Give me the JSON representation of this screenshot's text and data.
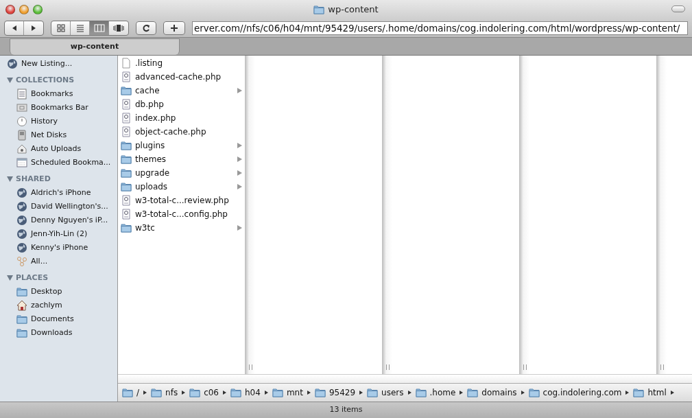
{
  "window": {
    "title": "wp-content"
  },
  "toolbar": {
    "view_buttons": [
      {
        "kind": "icons",
        "selected": false
      },
      {
        "kind": "list",
        "selected": false
      },
      {
        "kind": "columns",
        "selected": true
      },
      {
        "kind": "coverflow",
        "selected": false
      }
    ],
    "address": "erver.com//nfs/c06/h04/mnt/95429/users/.home/domains/cog.indolering.com/html/wordpress/wp-content/"
  },
  "tabs": [
    {
      "label": "wp-content",
      "selected": true
    }
  ],
  "sidebar": {
    "top_item": {
      "label": "New Listing...",
      "kind": "globe"
    },
    "sections": [
      {
        "title": "COLLECTIONS",
        "expanded": true,
        "items": [
          {
            "label": "Bookmarks",
            "kind": "list"
          },
          {
            "label": "Bookmarks Bar",
            "kind": "bar"
          },
          {
            "label": "History",
            "kind": "clock"
          },
          {
            "label": "Net Disks",
            "kind": "disk"
          },
          {
            "label": "Auto Uploads",
            "kind": "house"
          },
          {
            "label": "Scheduled Bookma...",
            "kind": "calendar"
          }
        ]
      },
      {
        "title": "SHARED",
        "expanded": true,
        "items": [
          {
            "label": "Aldrich's iPhone",
            "kind": "globe"
          },
          {
            "label": "David Wellington's...",
            "kind": "globe"
          },
          {
            "label": "Denny Nguyen's iP...",
            "kind": "globe"
          },
          {
            "label": "Jenn-Yih-Lin (2)",
            "kind": "globe"
          },
          {
            "label": "Kenny's iPhone",
            "kind": "globe"
          },
          {
            "label": "All...",
            "kind": "network"
          }
        ]
      },
      {
        "title": "PLACES",
        "expanded": true,
        "items": [
          {
            "label": "Desktop",
            "kind": "folder"
          },
          {
            "label": "zachlym",
            "kind": "home"
          },
          {
            "label": "Documents",
            "kind": "folder"
          },
          {
            "label": "Downloads",
            "kind": "folder"
          }
        ]
      }
    ]
  },
  "files": [
    {
      "name": ".listing",
      "kind": "file"
    },
    {
      "name": "advanced-cache.php",
      "kind": "php"
    },
    {
      "name": "cache",
      "kind": "folder"
    },
    {
      "name": "db.php",
      "kind": "php"
    },
    {
      "name": "index.php",
      "kind": "php"
    },
    {
      "name": "object-cache.php",
      "kind": "php"
    },
    {
      "name": "plugins",
      "kind": "folder"
    },
    {
      "name": "themes",
      "kind": "folder"
    },
    {
      "name": "upgrade",
      "kind": "folder"
    },
    {
      "name": "uploads",
      "kind": "folder"
    },
    {
      "name": "w3-total-c...review.php",
      "kind": "php"
    },
    {
      "name": "w3-total-c...config.php",
      "kind": "php"
    },
    {
      "name": "w3tc",
      "kind": "folder"
    }
  ],
  "path_bar": [
    "/",
    "nfs",
    "c06",
    "h04",
    "mnt",
    "95429",
    "users",
    ".home",
    "domains",
    "cog.indolering.com",
    "html"
  ],
  "status_bar": "13 items"
}
